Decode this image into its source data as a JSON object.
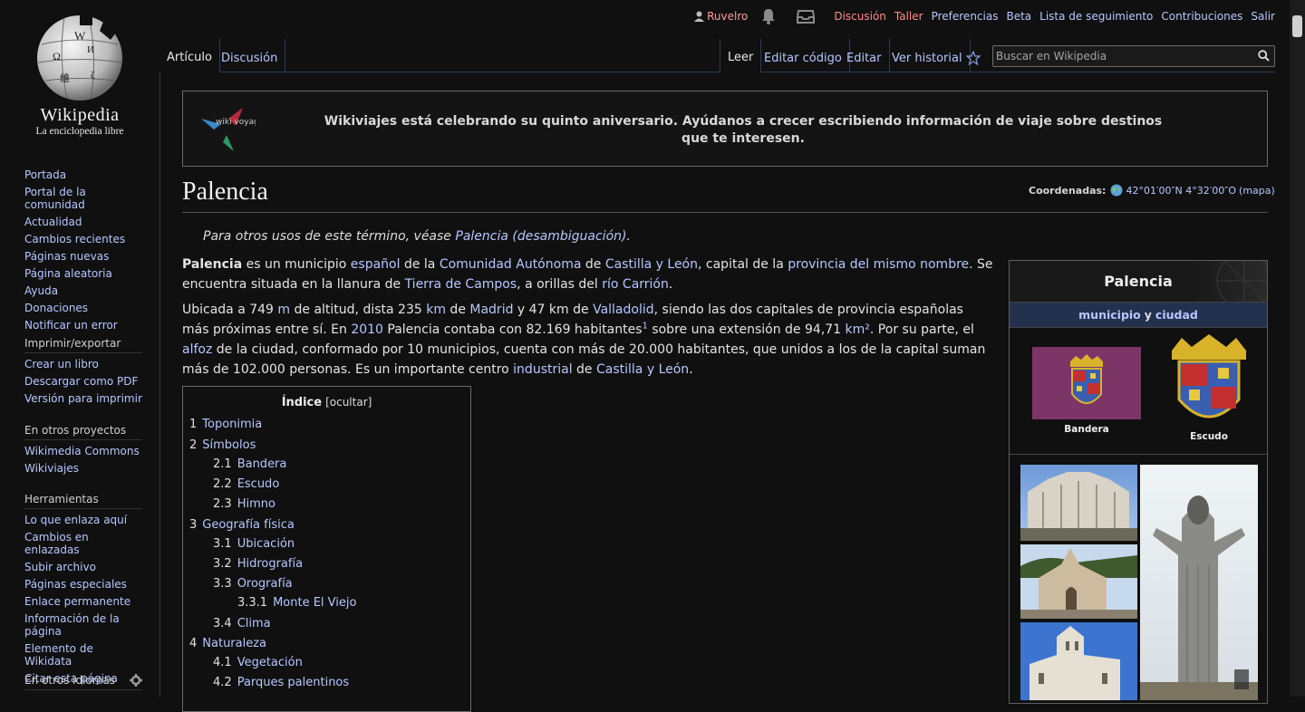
{
  "personal": {
    "user": "Ruvelro",
    "links": [
      "Discusión",
      "Taller",
      "Preferencias",
      "Beta",
      "Lista de seguimiento",
      "Contribuciones",
      "Salir"
    ]
  },
  "logo": {
    "wordmark": "Wikipedia",
    "tagline": "La enciclopedia libre"
  },
  "sidebar": {
    "nav": [
      "Portada",
      "Portal de la comunidad",
      "Actualidad",
      "Cambios recientes",
      "Páginas nuevas",
      "Página aleatoria",
      "Ayuda",
      "Donaciones",
      "Notificar un error"
    ],
    "print": {
      "title": "Imprimir/exportar",
      "items": [
        "Crear un libro",
        "Descargar como PDF",
        "Versión para imprimir"
      ]
    },
    "projects": {
      "title": "En otros proyectos",
      "items": [
        "Wikimedia Commons",
        "Wikiviajes"
      ]
    },
    "tools": {
      "title": "Herramientas",
      "items": [
        "Lo que enlaza aquí",
        "Cambios en enlazadas",
        "Subir archivo",
        "Páginas especiales",
        "Enlace permanente",
        "Información de la página",
        "Elemento de Wikidata",
        "Citar esta página"
      ]
    },
    "languages": {
      "title": "En otros idiomas"
    }
  },
  "tabs": {
    "article": "Artículo",
    "talk": "Discusión",
    "read": "Leer",
    "edit_source": "Editar código",
    "edit": "Editar",
    "history": "Ver historial"
  },
  "search": {
    "placeholder": "Buscar en Wikipedia"
  },
  "banner": {
    "logo_text": "wiki voyage",
    "text": "Wikiviajes está celebrando su quinto aniversario. Ayúdanos a crecer escribiendo información de viaje sobre destinos que te interesen."
  },
  "article": {
    "title": "Palencia",
    "coords_label": "Coordenadas:",
    "coords_value": "42°01′00″N 4°32′00″O",
    "coords_map": "(mapa)",
    "hatnote_prefix": "Para otros usos de este término, véase ",
    "hatnote_link": "Palencia (desambiguación)",
    "hatnote_suffix": ".",
    "p1": {
      "b": "Palencia",
      "t1": " es un municipio ",
      "l1": "español",
      "t2": " de la ",
      "l2": "Comunidad Autónoma",
      "t3": " de ",
      "l3": "Castilla y León",
      "t4": ", capital de la ",
      "l4": "provincia del mismo nombre",
      "t5": ". Se encuentra situada en la llanura de ",
      "l5": "Tierra de Campos",
      "t6": ", a orillas del ",
      "l6": "río Carrión",
      "t7": "."
    },
    "p2": {
      "t1": "Ubicada a 749 ",
      "l1": "m",
      "t2": " de altitud, dista 235 ",
      "l2": "km",
      "t3": " de ",
      "l3": "Madrid",
      "t4": " y 47 km de ",
      "l4": "Valladolid",
      "t5": ", siendo las dos capitales de provincia españolas más próximas entre sí. En ",
      "l5": "2010",
      "t6": " Palencia contaba con 82.169 habitantes",
      "sup": "1",
      "t7": " sobre una extensión de 94,71 ",
      "l7": "km²",
      "t8": ". Por su parte, el ",
      "l8": "alfoz",
      "t9": " de la ciudad, conformado por 10 municipios, cuenta con más de 20.000 habitantes, que unidos a los de la capital suman más de 102.000 personas. Es un importante centro ",
      "l9": "industrial",
      "t10": " de ",
      "l10": "Castilla y León",
      "t11": "."
    }
  },
  "toc": {
    "title": "Índice",
    "toggle": "[ocultar]",
    "items": [
      {
        "num": "1",
        "label": "Toponimia",
        "level": 1
      },
      {
        "num": "2",
        "label": "Símbolos",
        "level": 1
      },
      {
        "num": "2.1",
        "label": "Bandera",
        "level": 2
      },
      {
        "num": "2.2",
        "label": "Escudo",
        "level": 2
      },
      {
        "num": "2.3",
        "label": "Himno",
        "level": 2
      },
      {
        "num": "3",
        "label": "Geografía física",
        "level": 1
      },
      {
        "num": "3.1",
        "label": "Ubicación",
        "level": 2
      },
      {
        "num": "3.2",
        "label": "Hidrografía",
        "level": 2
      },
      {
        "num": "3.3",
        "label": "Orografía",
        "level": 2
      },
      {
        "num": "3.3.1",
        "label": "Monte El Viejo",
        "level": 3
      },
      {
        "num": "3.4",
        "label": "Clima",
        "level": 2
      },
      {
        "num": "4",
        "label": "Naturaleza",
        "level": 1
      },
      {
        "num": "4.1",
        "label": "Vegetación",
        "level": 2
      },
      {
        "num": "4.2",
        "label": "Parques palentinos",
        "level": 2
      }
    ]
  },
  "infobox": {
    "title": "Palencia",
    "sub_link1": "municipio",
    "sub_and": "y",
    "sub_link2": "ciudad",
    "flag_caption": "Bandera",
    "shield_caption": "Escudo"
  },
  "colors": {
    "background": "#101010",
    "link": "#b6c7ff",
    "user_link": "#ff9c9c",
    "infobox_header": "#24314e",
    "flag": "#7b3566"
  }
}
